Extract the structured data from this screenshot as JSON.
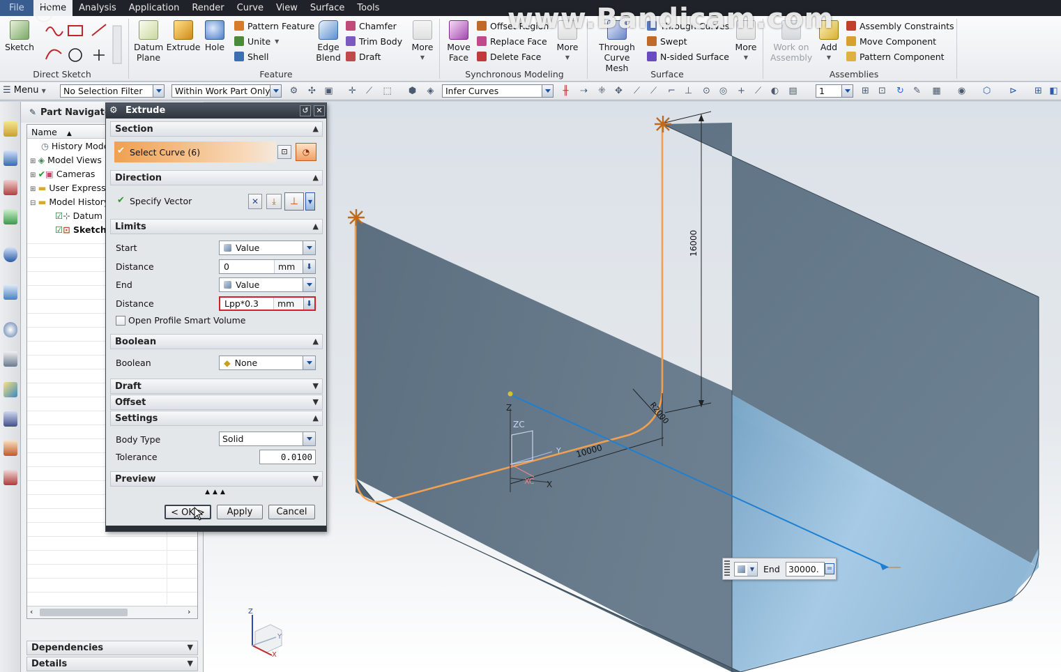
{
  "watermark": "www.Bandicam.com",
  "menubar": [
    "File",
    "Home",
    "Analysis",
    "Application",
    "Render",
    "Curve",
    "View",
    "Surface",
    "Tools"
  ],
  "ribbon": {
    "direct_sketch": {
      "sketch": "Sketch",
      "group_label": "Direct Sketch"
    },
    "feature": {
      "datum_plane": "Datum Plane",
      "extrude": "Extrude",
      "hole": "Hole",
      "pattern_feature": "Pattern Feature",
      "unite": "Unite",
      "shell": "Shell",
      "edge_blend": "Edge Blend",
      "chamfer": "Chamfer",
      "trim_body": "Trim Body",
      "draft": "Draft",
      "more": "More",
      "group_label": "Feature"
    },
    "sync_modeling": {
      "move_face": "Move Face",
      "offset_region": "Offset Region",
      "replace_face": "Replace Face",
      "delete_face": "Delete Face",
      "more": "More",
      "group_label": "Synchronous Modeling"
    },
    "surface": {
      "through_curve_mesh": "Through Curve Mesh",
      "through_curves": "Through Curves",
      "swept": "Swept",
      "n_sided": "N-sided Surface",
      "more": "More",
      "group_label": "Surface"
    },
    "assemblies": {
      "work_on_assembly": "Work on Assembly",
      "add": "Add",
      "assembly_constraints": "Assembly Constraints",
      "move_component": "Move Component",
      "pattern_component": "Pattern Component",
      "group_label": "Assemblies"
    }
  },
  "toolbar": {
    "menu": "Menu",
    "selection_filter": "No Selection Filter",
    "scope": "Within Work Part Only",
    "curve_rule": "Infer Curves",
    "layer": "1"
  },
  "navigator": {
    "title": "Part Navigator",
    "column_name": "Name",
    "items": [
      "History Mode",
      "Model Views",
      "Cameras",
      "User Expressions",
      "Model History",
      "Datum",
      "Sketch"
    ],
    "dependencies": "Dependencies",
    "details": "Details"
  },
  "dialog": {
    "title": "Extrude",
    "section": {
      "header": "Section",
      "select_curve": "Select Curve (6)"
    },
    "direction": {
      "header": "Direction",
      "specify_vector": "Specify Vector"
    },
    "limits": {
      "header": "Limits",
      "start_label": "Start",
      "start_value": "Value",
      "distance_label": "Distance",
      "start_distance": "0",
      "unit": "mm",
      "end_label": "End",
      "end_value": "Value",
      "end_distance": "Lpp*0.3",
      "open_profile": "Open Profile Smart Volume"
    },
    "boolean": {
      "header": "Boolean",
      "label": "Boolean",
      "value": "None"
    },
    "draft": {
      "header": "Draft"
    },
    "offset": {
      "header": "Offset"
    },
    "settings": {
      "header": "Settings",
      "body_type_label": "Body Type",
      "body_type": "Solid",
      "tolerance_label": "Tolerance",
      "tolerance": "0.0100"
    },
    "preview": {
      "header": "Preview"
    },
    "buttons": {
      "ok": "< OK >",
      "apply": "Apply",
      "cancel": "Cancel"
    }
  },
  "viewport": {
    "dim_height": "16000",
    "dim_length": "10000",
    "dim_radius": "R2000",
    "axis_z": "Z",
    "axis_zc": "ZC",
    "axis_y": "Y",
    "axis_x": "X",
    "axis_xc": "XC",
    "triad_z": "Z",
    "triad_y": "Y",
    "triad_x": "X",
    "end_label": "End",
    "end_value": "30000."
  },
  "colors": {
    "accent": "#f0a050",
    "curve": "#ee9a4a",
    "vector": "#1f7fd0",
    "error_border": "#d0202a"
  }
}
